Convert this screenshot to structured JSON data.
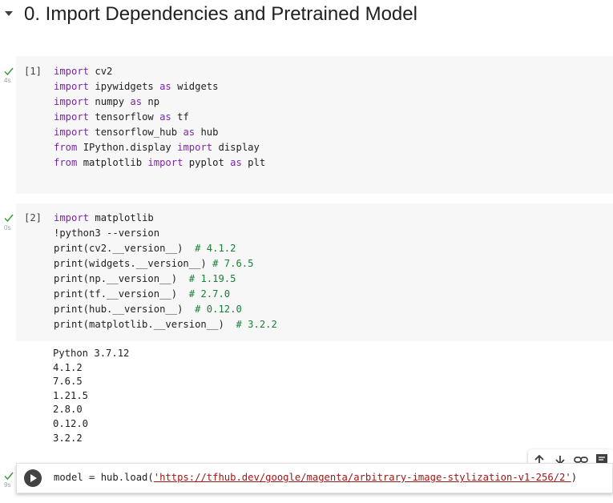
{
  "section": {
    "title": "0. Import Dependencies and Pretrained Model"
  },
  "cells": [
    {
      "count": "[1]",
      "time": "4s",
      "lines": [
        [
          [
            "kw",
            "import"
          ],
          [
            "t",
            " cv2"
          ]
        ],
        [
          [
            "kw",
            "import"
          ],
          [
            "t",
            " ipywidgets "
          ],
          [
            "kw",
            "as"
          ],
          [
            "t",
            " widgets"
          ]
        ],
        [
          [
            "kw",
            "import"
          ],
          [
            "t",
            " numpy "
          ],
          [
            "kw",
            "as"
          ],
          [
            "t",
            " np"
          ]
        ],
        [
          [
            "kw",
            "import"
          ],
          [
            "t",
            " tensorflow "
          ],
          [
            "kw",
            "as"
          ],
          [
            "t",
            " tf"
          ]
        ],
        [
          [
            "kw",
            "import"
          ],
          [
            "t",
            " tensorflow_hub "
          ],
          [
            "kw",
            "as"
          ],
          [
            "t",
            " hub"
          ]
        ],
        [
          [
            "kw",
            "from"
          ],
          [
            "t",
            " IPython.display "
          ],
          [
            "kw",
            "import"
          ],
          [
            "t",
            " display"
          ]
        ],
        [
          [
            "kw",
            "from"
          ],
          [
            "t",
            " matplotlib "
          ],
          [
            "kw",
            "import"
          ],
          [
            "t",
            " pyplot "
          ],
          [
            "kw",
            "as"
          ],
          [
            "t",
            " plt"
          ]
        ]
      ]
    },
    {
      "count": "[2]",
      "time": "0s",
      "lines": [
        [
          [
            "kw",
            "import"
          ],
          [
            "t",
            " matplotlib"
          ]
        ],
        [
          [
            "t",
            "!python3 --version"
          ]
        ],
        [
          [
            "t",
            "print(cv2.__version__)  "
          ],
          [
            "cm",
            "# 4.1.2"
          ]
        ],
        [
          [
            "t",
            "print(widgets.__version__) "
          ],
          [
            "cm",
            "# 7.6.5"
          ]
        ],
        [
          [
            "t",
            "print(np.__version__)  "
          ],
          [
            "cm",
            "# 1.19.5"
          ]
        ],
        [
          [
            "t",
            "print(tf.__version__)  "
          ],
          [
            "cm",
            "# 2.7.0"
          ]
        ],
        [
          [
            "t",
            "print(hub.__version__)  "
          ],
          [
            "cm",
            "# 0.12.0"
          ]
        ],
        [
          [
            "t",
            "print(matplotlib.__version__)  "
          ],
          [
            "cm",
            "# 3.2.2"
          ]
        ]
      ],
      "output": [
        "Python 3.7.12",
        "4.1.2",
        "7.6.5",
        "1.21.5",
        "2.8.0",
        "0.12.0",
        "3.2.2"
      ]
    },
    {
      "time": "9s",
      "lines": [
        [
          [
            "t",
            "model = hub.load("
          ],
          [
            "str",
            "'https://tfhub.dev/google/magenta/arbitrary-image-stylization-v1-256/2'"
          ],
          [
            "t",
            ")"
          ]
        ]
      ]
    }
  ],
  "toolbar": {
    "icons": [
      "arrow-up-icon",
      "arrow-down-icon",
      "link-icon",
      "comment-icon"
    ]
  },
  "colors": {
    "keyword": "#7928a1",
    "comment": "#1a7f37",
    "string": "#a31515",
    "check": "#3c9a3c"
  }
}
